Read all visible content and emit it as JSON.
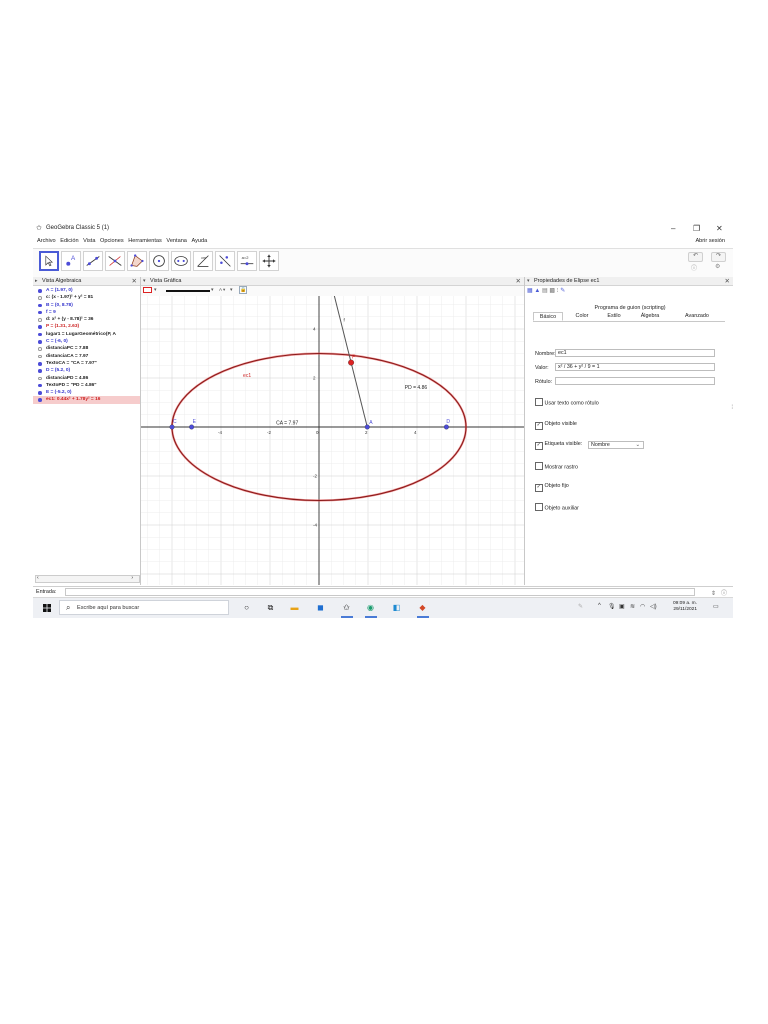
{
  "window": {
    "title": "GeoGebra Classic 5 (1)",
    "controls": [
      "–",
      "❐",
      "✕"
    ]
  },
  "menu": {
    "items": [
      "Archivo",
      "Edición",
      "Vista",
      "Opciones",
      "Herramientas",
      "Ventana",
      "Ayuda"
    ],
    "login": "Abrir sesión"
  },
  "toolbar": {
    "tools": [
      "move-tool",
      "point-tool",
      "line-tool",
      "perpendicular-tool",
      "polygon-tool",
      "circle-tool",
      "ellipse-tool",
      "angle-tool",
      "reflect-tool",
      "slider-tool",
      "move-graphics-tool"
    ],
    "slider_label": "a=2"
  },
  "algebra": {
    "title": "Vista Algebraica",
    "items": [
      {
        "text": "A = (1.97, 0)",
        "dot": "on",
        "color": "#3333cc",
        "bold": true
      },
      {
        "text": "c: (x - 1.97)² + y² = 81",
        "dot": "off",
        "color": "#222222",
        "bold": true
      },
      {
        "text": "B = (0, 8.78)",
        "dot": "on",
        "color": "#3333cc",
        "bold": true
      },
      {
        "text": "f = 9",
        "dot": "on",
        "color": "#3333cc",
        "bold": true
      },
      {
        "text": "d: x² + (y - 8.78)² = 36",
        "dot": "off",
        "color": "#222222",
        "bold": true
      },
      {
        "text": "P = (1.31, 2.63)",
        "dot": "on",
        "color": "#cc2222",
        "bold": true
      },
      {
        "text": "lugar1 = LugarGeométrico(P, A",
        "dot": "on",
        "color": "#222222",
        "bold": true
      },
      {
        "text": "C = (-6, 0)",
        "dot": "on",
        "color": "#3333cc",
        "bold": true
      },
      {
        "text": "distanciaPC = 7.88",
        "dot": "off",
        "color": "#222222",
        "bold": true
      },
      {
        "text": "distanciaCA = 7.97",
        "dot": "off",
        "color": "#222222",
        "bold": true
      },
      {
        "text": "TextoCA = \"CA = 7.97\"",
        "dot": "on",
        "color": "#222222",
        "bold": true
      },
      {
        "text": "D = (5.2, 0)",
        "dot": "on",
        "color": "#3333cc",
        "bold": true
      },
      {
        "text": "distanciaPD = 4.86",
        "dot": "off",
        "color": "#222222",
        "bold": true
      },
      {
        "text": "TextoPD = \"PD = 4.86\"",
        "dot": "on",
        "color": "#222222",
        "bold": true
      },
      {
        "text": "E = (-5.2, 0)",
        "dot": "on",
        "color": "#3333cc",
        "bold": true
      },
      {
        "text": "ec1: 0.44x² + 1.78y² = 16",
        "dot": "on",
        "color": "#cc2222",
        "bold": true,
        "highlight": true
      }
    ],
    "scroll_left": "‹",
    "scroll_right": "›"
  },
  "graphics": {
    "title": "Vista Gráfica",
    "axis_x_ticks": [
      "-4",
      "-2",
      "0",
      "2",
      "4"
    ],
    "axis_y_ticks": [
      "6",
      "4",
      "2",
      "-2",
      "-4"
    ],
    "labels": {
      "P": "P",
      "A": "A",
      "C": "C",
      "D": "D",
      "E": "E",
      "ec1": "ec1",
      "f": "f",
      "CA": "CA = 7.97",
      "PD": "PD = 4.86"
    },
    "colors": {
      "ellipse": "#8b1a1a",
      "locus": "#e84a4a",
      "point": "#4c4cd8",
      "p": "#dd2222",
      "line": "#555555"
    }
  },
  "properties": {
    "title": "Propiedades de Elipse ec1",
    "script_label": "Programa de guion (scripting)",
    "tabs": [
      "Básico",
      "Color",
      "Estilo",
      "Álgebra",
      "Avanzado"
    ],
    "active_tab": "Básico",
    "name_label": "Nombre:",
    "name_value": "ec1",
    "value_label": "Valor:",
    "value_value": "x² / 36 + y² / 9 = 1",
    "caption_label": "Rótulo:",
    "caption_value": "",
    "use_text_caption": "Usar texto como rótulo",
    "show_object": "Objeto visible",
    "show_label": "Etiqueta visible:",
    "label_mode": "Nombre",
    "trace": "Mostrar rastro",
    "fixed": "Objeto fijo",
    "auxiliary": "Objeto auxiliar"
  },
  "input": {
    "label": "Entrada:"
  },
  "taskbar": {
    "search_placeholder": "Escribe aquí para buscar",
    "time": "09:09 a. m.",
    "date": "29/11/2021"
  }
}
